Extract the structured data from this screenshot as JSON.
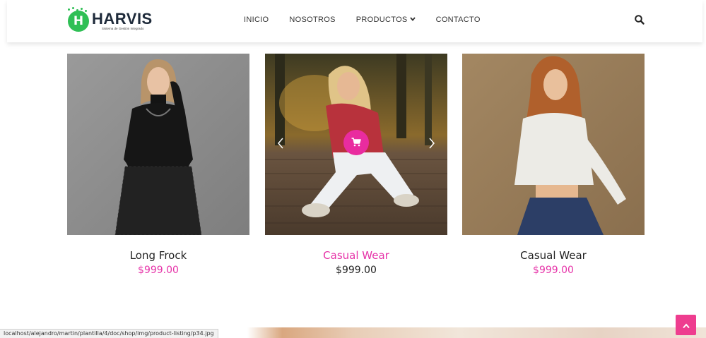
{
  "header": {
    "logo": {
      "mark": "H",
      "name": "HARVIS",
      "tagline": "Sistema de Gestión Integrado"
    },
    "nav": [
      {
        "label": "INICIO"
      },
      {
        "label": "NOSOTROS"
      },
      {
        "label": "PRODUCTOS",
        "has_dropdown": true
      },
      {
        "label": "CONTACTO"
      }
    ],
    "search_icon": "search-icon"
  },
  "products": [
    {
      "name": "Long Frock",
      "price": "$999.00",
      "active": false
    },
    {
      "name": "Casual Wear",
      "price": "$999.00",
      "active": true
    },
    {
      "name": "Casual Wear",
      "price": "$999.00",
      "active": false
    }
  ],
  "icons": {
    "cart": "cart-icon",
    "prev": "chevron-left-icon",
    "next": "chevron-right-icon",
    "scroll_top": "chevron-up-icon"
  },
  "colors": {
    "accent": "#e633a8",
    "cart_button": "#e92c9f",
    "scroll_top": "#ee3d8f",
    "logo_green": "#2fbf55"
  },
  "status_bar": {
    "url": "localhost/alejandro/martin/plantilla/4/doc/shop/img/product-listing/p34.jpg"
  }
}
